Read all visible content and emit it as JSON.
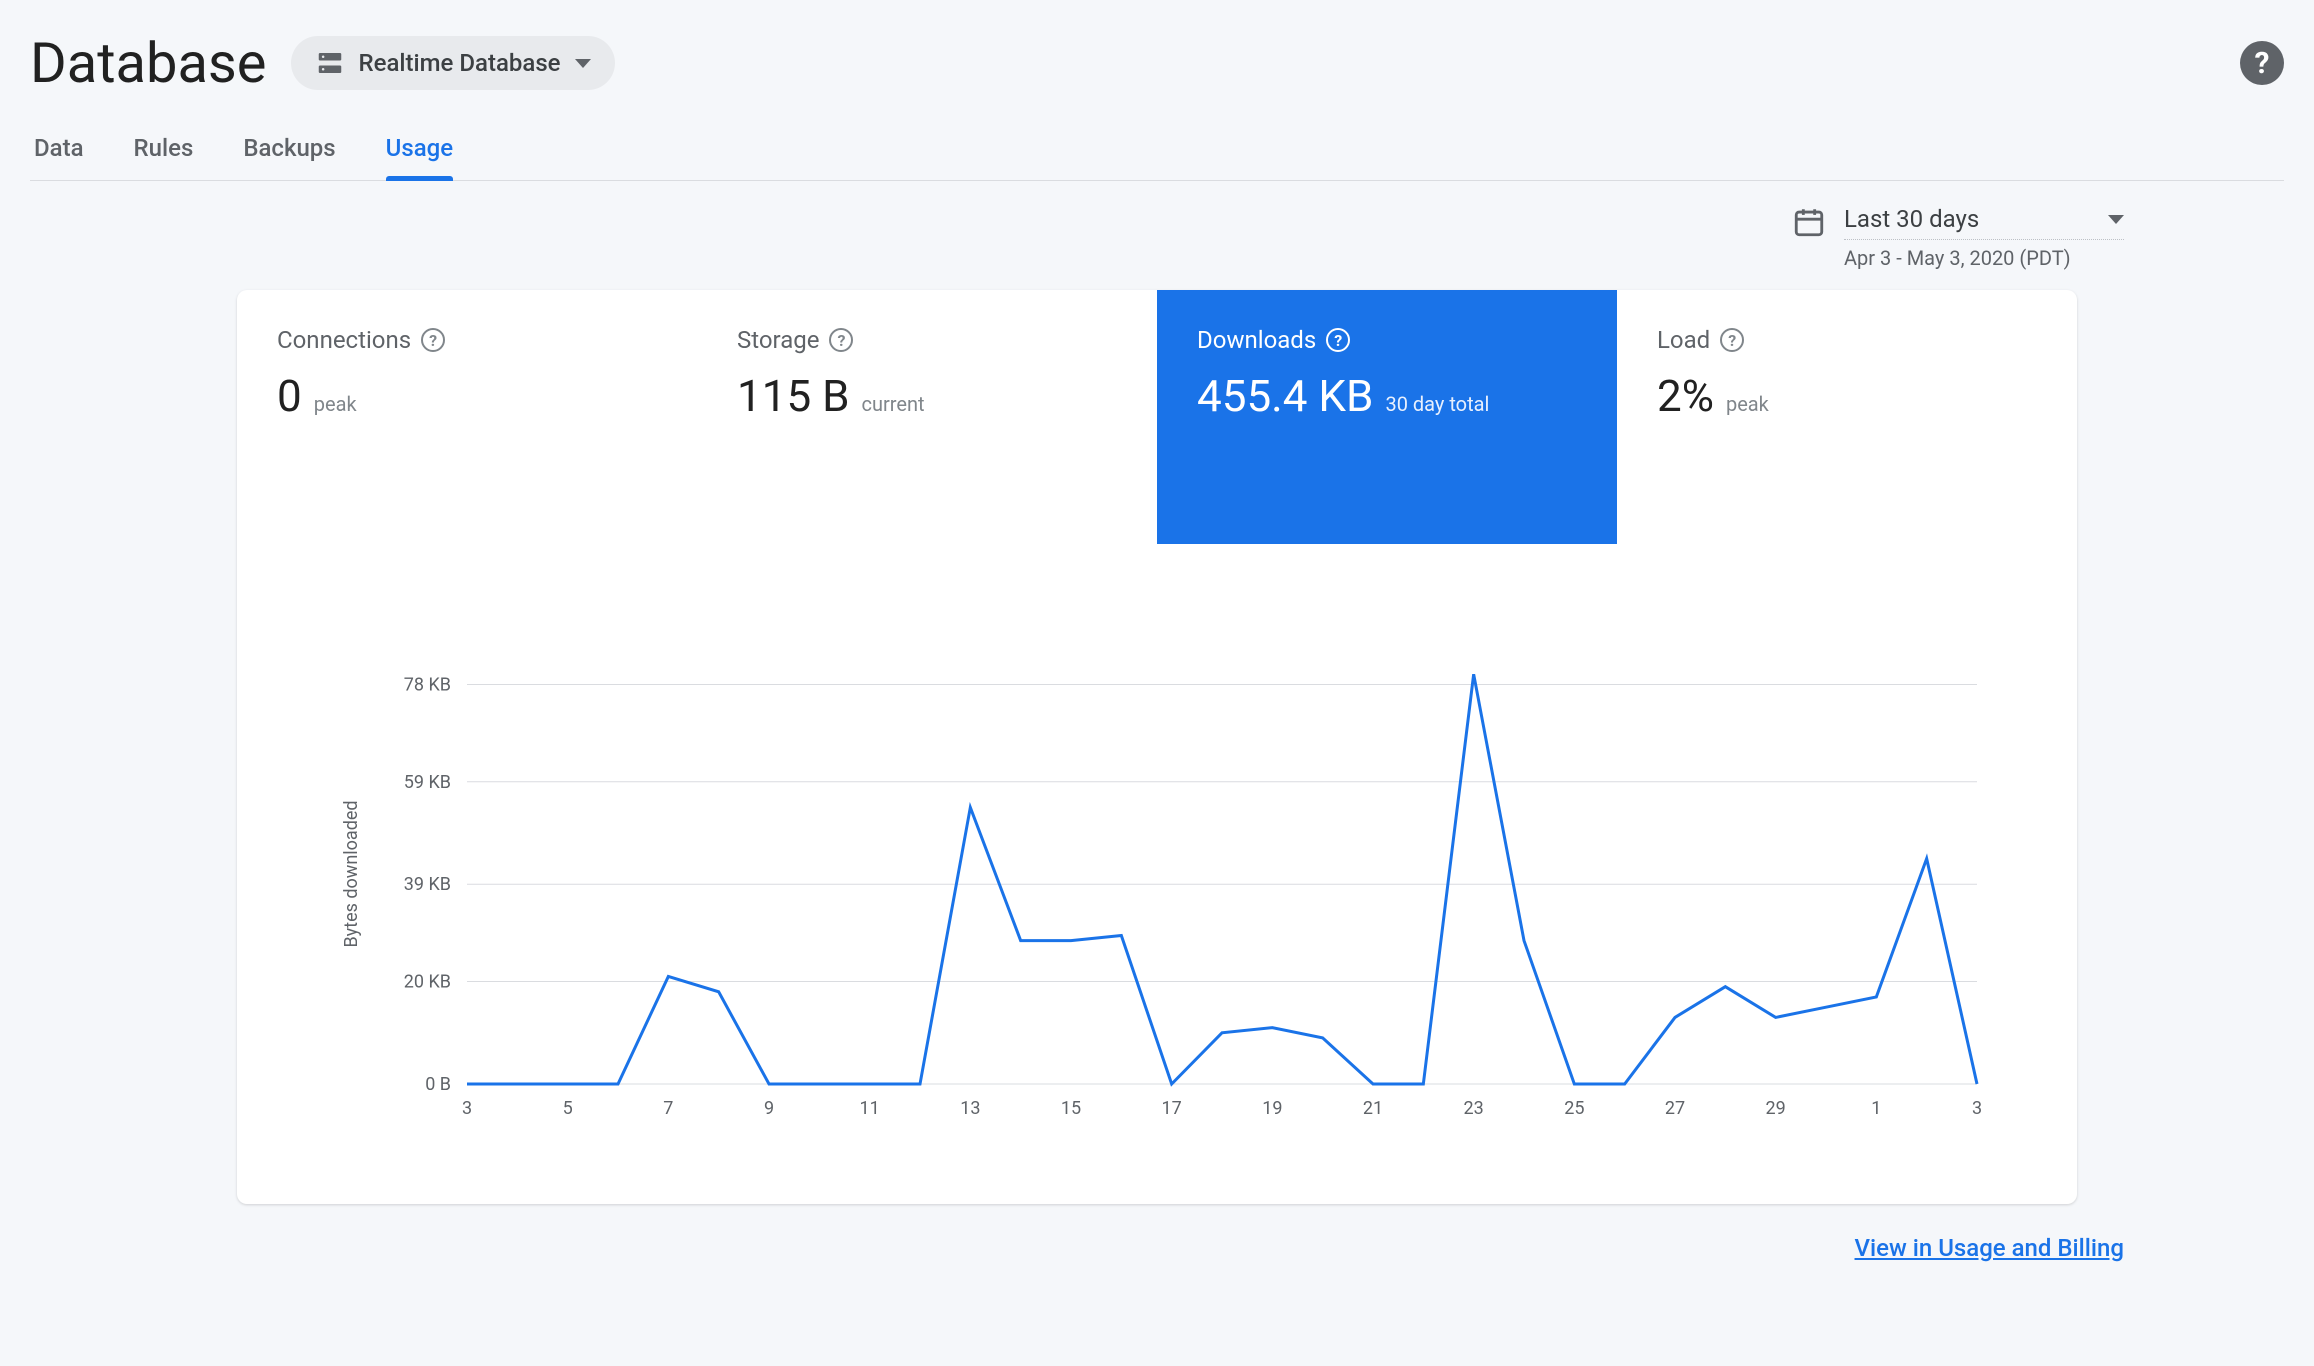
{
  "header": {
    "title": "Database",
    "selector_label": "Realtime Database"
  },
  "tabs": {
    "data": "Data",
    "rules": "Rules",
    "backups": "Backups",
    "usage": "Usage"
  },
  "date": {
    "label": "Last 30 days",
    "range": "Apr 3 - May 3, 2020 (PDT)"
  },
  "metrics": {
    "connections": {
      "title": "Connections",
      "value": "0",
      "sub": "peak"
    },
    "storage": {
      "title": "Storage",
      "value": "115 B",
      "sub": "current"
    },
    "downloads": {
      "title": "Downloads",
      "value": "455.4 KB",
      "sub": "30 day total"
    },
    "load": {
      "title": "Load",
      "value": "2%",
      "sub": "peak"
    }
  },
  "footer": {
    "link": "View in Usage and Billing"
  },
  "chart_data": {
    "type": "line",
    "title": "",
    "ylabel": "Bytes downloaded",
    "xlabel": "",
    "y_ticks": [
      "0 B",
      "20 KB",
      "39 KB",
      "59 KB",
      "78 KB"
    ],
    "y_tick_values": [
      0,
      20,
      39,
      59,
      78
    ],
    "ylim": [
      0,
      82
    ],
    "x_tick_labels": [
      "3",
      "5",
      "7",
      "9",
      "11",
      "13",
      "15",
      "17",
      "19",
      "21",
      "23",
      "25",
      "27",
      "29",
      "1",
      "3"
    ],
    "categories": [
      "3",
      "4",
      "5",
      "6",
      "7",
      "8",
      "9",
      "10",
      "11",
      "12",
      "13",
      "14",
      "15",
      "16",
      "17",
      "18",
      "19",
      "20",
      "21",
      "22",
      "23",
      "24",
      "25",
      "26",
      "27",
      "28",
      "29",
      "30",
      "1",
      "2",
      "3"
    ],
    "values": [
      0,
      0,
      0,
      0,
      21,
      18,
      0,
      0,
      0,
      0,
      54,
      28,
      28,
      29,
      0,
      10,
      11,
      9,
      0,
      0,
      80,
      28,
      0,
      0,
      13,
      19,
      13,
      15,
      17,
      44,
      0
    ],
    "unit": "KB",
    "series_color": "#1a73e8"
  }
}
